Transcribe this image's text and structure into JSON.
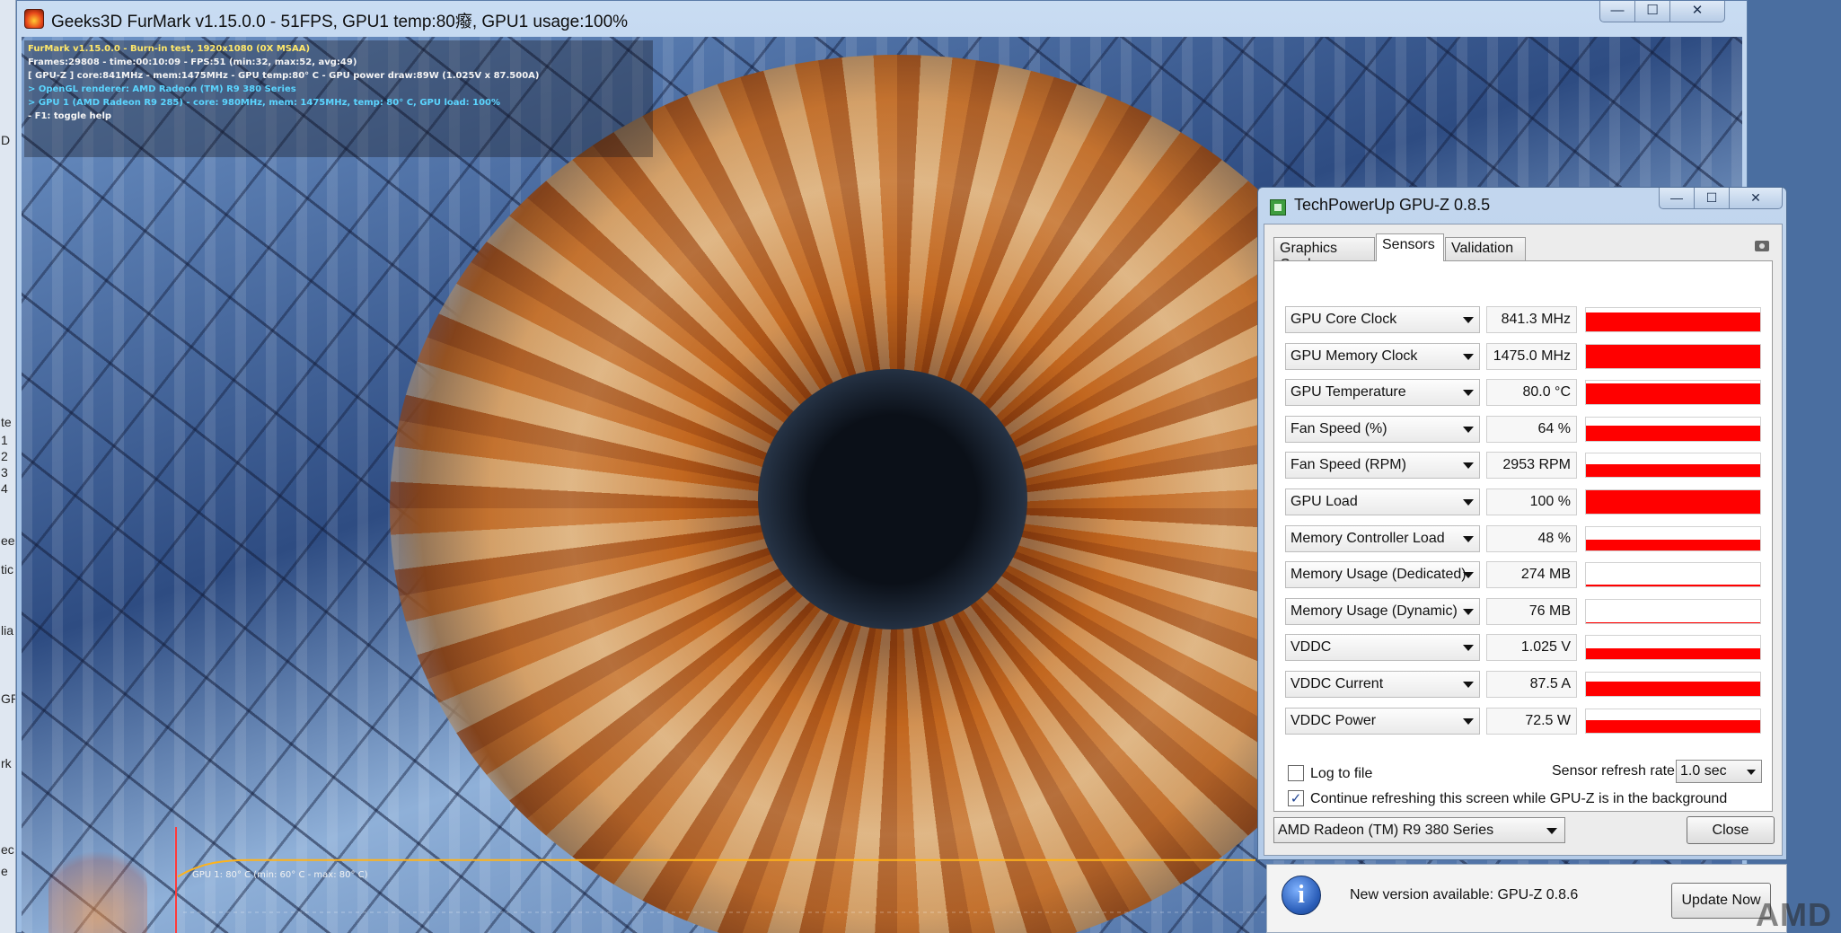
{
  "furmark": {
    "title": "Geeks3D FurMark v1.15.0.0 - 51FPS, GPU1 temp:80癈, GPU1 usage:100%",
    "window_buttons": {
      "minimize": "—",
      "maximize": "☐",
      "close": "✕"
    },
    "osd": [
      "FurMark v1.15.0.0 - Burn-in test, 1920x1080 (0X MSAA)",
      "Frames:29808 - time:00:10:09 - FPS:51 (min:32, max:52, avg:49)",
      "[ GPU-Z ] core:841MHz - mem:1475MHz - GPU temp:80° C - GPU power draw:89W (1.025V x 87.500A)",
      "> OpenGL renderer: AMD Radeon (TM) R9 380 Series",
      "> GPU 1 (AMD Radeon R9 285) - core: 980MHz, mem: 1475MHz, temp: 80° C, GPU load: 100%",
      "- F1: toggle help"
    ],
    "graph_label": "GPU 1: 80° C (min: 60° C - max: 80° C)",
    "temp_graph": {
      "min": 60,
      "max": 80,
      "current": 80,
      "axis_min": 0,
      "axis_max": 100
    }
  },
  "left_strip": [
    "D",
    "te",
    "1",
    "2",
    "3",
    "4",
    "ee",
    "tic",
    "lia",
    "GP",
    "rk",
    "ec",
    "e"
  ],
  "gpuz": {
    "title": "TechPowerUp GPU-Z 0.8.5",
    "window_buttons": {
      "minimize": "—",
      "maximize": "☐",
      "close": "✕"
    },
    "tabs": [
      {
        "label": "Graphics Card",
        "active": false
      },
      {
        "label": "Sensors",
        "active": true
      },
      {
        "label": "Validation",
        "active": false
      }
    ],
    "sensors": [
      {
        "name": "GPU Core Clock",
        "value": "841.3 MHz",
        "level": 0.82
      },
      {
        "name": "GPU Memory Clock",
        "value": "1475.0 MHz",
        "level": 1.0
      },
      {
        "name": "GPU Temperature",
        "value": "80.0 °C",
        "level": 0.9
      },
      {
        "name": "Fan Speed (%)",
        "value": "64 %",
        "level": 0.64
      },
      {
        "name": "Fan Speed (RPM)",
        "value": "2953 RPM",
        "level": 0.55
      },
      {
        "name": "GPU Load",
        "value": "100 %",
        "level": 1.0
      },
      {
        "name": "Memory Controller Load",
        "value": "48 %",
        "level": 0.48
      },
      {
        "name": "Memory Usage (Dedicated)",
        "value": "274 MB",
        "level": 0.07
      },
      {
        "name": "Memory Usage (Dynamic)",
        "value": "76 MB",
        "level": 0.03
      },
      {
        "name": "VDDC",
        "value": "1.025 V",
        "level": 0.45
      },
      {
        "name": "VDDC Current",
        "value": "87.5 A",
        "level": 0.6
      },
      {
        "name": "VDDC Power",
        "value": "72.5 W",
        "level": 0.55
      }
    ],
    "log_to_file": {
      "label": "Log to file",
      "checked": false
    },
    "refresh_rate": {
      "label": "Sensor refresh rate:",
      "value": "1.0 sec"
    },
    "background_refresh": {
      "label": "Continue refreshing this screen while GPU-Z is in the background",
      "checked": true,
      "mark": "✓"
    },
    "card_select": "AMD Radeon (TM) R9 380 Series",
    "close_label": "Close",
    "update": {
      "icon": "i",
      "text": "New version available: GPU-Z 0.8.6",
      "button": "Update Now"
    }
  },
  "amd_logo": "AMD",
  "colors": {
    "graph_fill": "#ff0000",
    "osd_title": "#ffe86a",
    "osd_info": "#5bd5ff"
  }
}
